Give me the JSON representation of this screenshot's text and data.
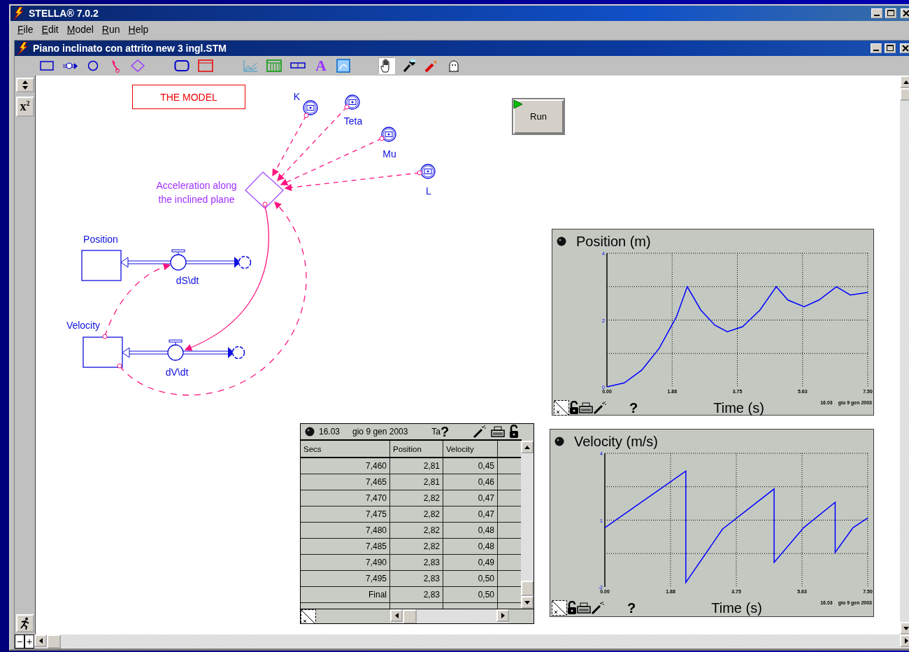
{
  "app": {
    "title": "STELLA® 7.0.2"
  },
  "menu": [
    {
      "label": "File"
    },
    {
      "label": "Edit"
    },
    {
      "label": "Model"
    },
    {
      "label": "Run"
    },
    {
      "label": "Help"
    }
  ],
  "document": {
    "title": "Piano inclinato con attrito new 3 ingl.STM"
  },
  "toolbar": [
    [
      {
        "kind": "stock",
        "selected": false
      },
      {
        "kind": "flow",
        "selected": false
      },
      {
        "kind": "converter",
        "selected": false
      },
      {
        "kind": "connector",
        "selected": false
      },
      {
        "kind": "decision",
        "selected": false
      }
    ],
    [
      {
        "kind": "module",
        "selected": false
      },
      {
        "kind": "sector",
        "selected": false
      }
    ],
    [
      {
        "kind": "graph",
        "selected": false
      },
      {
        "kind": "table",
        "selected": false
      },
      {
        "kind": "slider",
        "selected": false
      },
      {
        "kind": "text",
        "label": "A",
        "selected": false
      },
      {
        "kind": "picture",
        "selected": false
      }
    ],
    [
      {
        "kind": "hand",
        "selected": true
      },
      {
        "kind": "brush",
        "selected": false
      },
      {
        "kind": "dynamite",
        "selected": false
      },
      {
        "kind": "ghost",
        "selected": false
      }
    ]
  ],
  "palette": {
    "math_label": "x$^{2}$",
    "zoom_out": "−",
    "zoom_in": "+"
  },
  "model": {
    "title": "THE MODEL",
    "run_label": "Run",
    "converters": [
      {
        "name": "K"
      },
      {
        "name": "Teta"
      },
      {
        "name": "Mu"
      },
      {
        "name": "L"
      }
    ],
    "auxiliary": {
      "label_lines": [
        "Acceleration along",
        "the inclined plane"
      ]
    },
    "stocks": [
      {
        "name": "Position",
        "flow": "dS\\dt"
      },
      {
        "name": "Velocity",
        "flow": "dV\\dt"
      }
    ]
  },
  "table": {
    "time": "16.03",
    "date": "gio 9 gen 2003",
    "title": "Ta",
    "help": "?",
    "columns": [
      "Secs",
      "Position",
      "Velocity"
    ],
    "rows": [
      [
        "7,460",
        "2,81",
        "0,45"
      ],
      [
        "7,465",
        "2,81",
        "0,46"
      ],
      [
        "7,470",
        "2,82",
        "0,47"
      ],
      [
        "7,475",
        "2,82",
        "0,47"
      ],
      [
        "7,480",
        "2,82",
        "0,48"
      ],
      [
        "7,485",
        "2,82",
        "0,48"
      ],
      [
        "7,490",
        "2,83",
        "0,49"
      ],
      [
        "7,495",
        "2,83",
        "0,50"
      ],
      [
        "Final",
        "2,83",
        "0,50"
      ]
    ]
  },
  "graphs": [
    {
      "help": "?",
      "time": "16.03",
      "date": "gio 9 gen 2003",
      "chart_data": {
        "type": "line",
        "title": "Position (m)",
        "xlabel": "Time (s)",
        "xlim": [
          0,
          7.5
        ],
        "ylim": [
          0,
          4
        ],
        "xticks": [
          {
            "value": 0,
            "label": "0.00"
          },
          {
            "value": 1.875,
            "label": "1.88"
          },
          {
            "value": 3.75,
            "label": "3.75"
          },
          {
            "value": 5.625,
            "label": "5.63"
          },
          {
            "value": 7.5,
            "label": "7.50"
          }
        ],
        "yticks": [
          0,
          2,
          4
        ],
        "x": [
          0,
          0.5,
          1,
          1.5,
          2,
          2.31,
          2.7,
          3.1,
          3.46,
          3.9,
          4.4,
          4.87,
          5.2,
          5.67,
          6.1,
          6.6,
          7.0,
          7.5
        ],
        "grid": true,
        "series": [
          {
            "color": "#0000ff",
            "values": [
              0,
              0.12,
              0.5,
              1.15,
              2.1,
              3.0,
              2.3,
              1.85,
              1.65,
              1.8,
              2.3,
              3.0,
              2.6,
              2.4,
              2.6,
              3.0,
              2.75,
              2.83
            ]
          }
        ]
      }
    },
    {
      "help": "?",
      "time": "16.03",
      "date": "gio 9 gen 2003",
      "chart_data": {
        "type": "line",
        "title": "Velocity (m/s)",
        "xlabel": "Time (s)",
        "xlim": [
          0,
          7.5
        ],
        "ylim": [
          -2,
          4
        ],
        "xticks": [
          {
            "value": 0,
            "label": "0.00"
          },
          {
            "value": 1.875,
            "label": "1.88"
          },
          {
            "value": 3.75,
            "label": "3.75"
          },
          {
            "value": 5.625,
            "label": "5.63"
          },
          {
            "value": 7.5,
            "label": "7.50"
          }
        ],
        "yticks": [
          -2,
          1,
          4
        ],
        "x": [
          0,
          2.31,
          2.31,
          3.36,
          4.83,
          4.83,
          5.67,
          6.57,
          6.57,
          7.08,
          7.5
        ],
        "grid": true,
        "series": [
          {
            "color": "#0000ff",
            "values": [
              0.66,
              3.2,
              -1.8,
              0.6,
              2.4,
              -0.9,
              0.66,
              1.8,
              -0.45,
              0.66,
              1.1
            ]
          }
        ]
      }
    }
  ]
}
